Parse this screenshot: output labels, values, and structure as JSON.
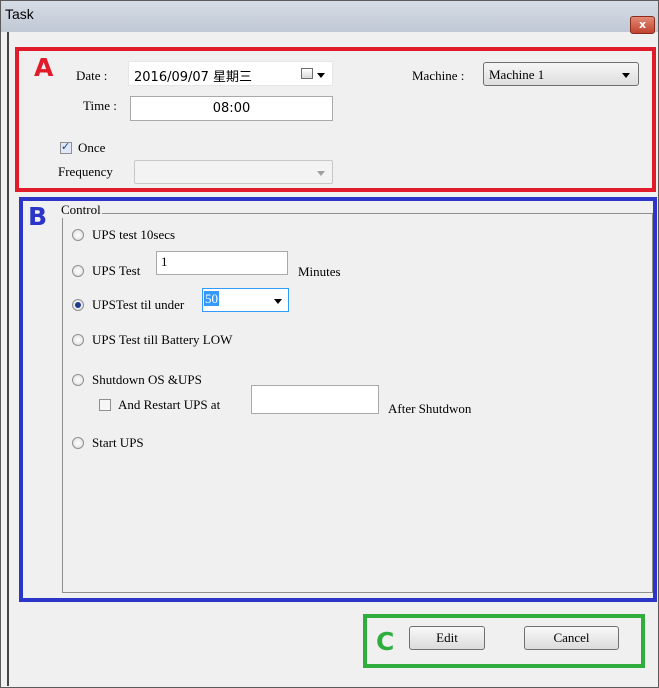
{
  "window": {
    "title": "Task",
    "close_glyph": "x"
  },
  "annotations": {
    "a": "A",
    "b": "B",
    "c": "C"
  },
  "colors": {
    "annotation_a": "#e21b2a",
    "annotation_b": "#2b35c8",
    "annotation_c": "#2fae3e",
    "selection_highlight": "#3399ff"
  },
  "schedule": {
    "date_label": "Date :",
    "date_value": "2016/09/07 星期三",
    "time_label": "Time :",
    "time_value": "08:00",
    "machine_label": "Machine :",
    "machine_value": "Machine 1",
    "once_label": "Once",
    "once_checked": true,
    "frequency_label": "Frequency",
    "frequency_value": ""
  },
  "control": {
    "group_label": "Control",
    "options": {
      "ups_test_10": "UPS test 10secs",
      "ups_test": "UPS Test",
      "ups_test_under": "UPSTest til under",
      "ups_test_battery_low": "UPS Test till Battery LOW",
      "shutdown": "Shutdown OS &UPS",
      "start_ups": "Start UPS"
    },
    "selected_option": "ups_test_under",
    "ups_test_minutes_value": "1",
    "minutes_label": "Minutes",
    "under_value": "50",
    "restart_label": "And Restart UPS at",
    "restart_checked": false,
    "restart_value": "",
    "after_shutdown_label": "After Shutdwon"
  },
  "footer": {
    "edit_label": "Edit",
    "cancel_label": "Cancel"
  },
  "icons": {
    "calendar": "calendar-icon",
    "dropdown": "chevron-down-icon"
  }
}
